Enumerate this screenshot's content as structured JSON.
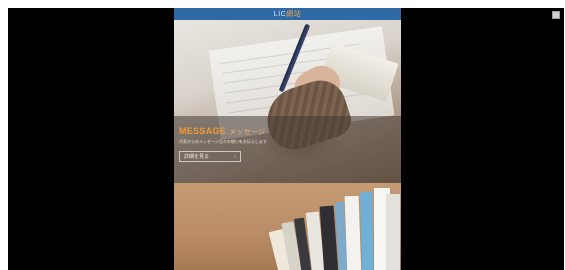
{
  "header": {
    "logo_part1": "LIC",
    "logo_part2": "網站"
  },
  "hero": {
    "title": "MESSAGE",
    "title_suffix": "メッセージ",
    "subtitle": "代表からのメッセージ日々の想いをお伝えします",
    "button_label": "詳細を見る",
    "button_arrow": "›"
  },
  "colors": {
    "header_bg": "#2f6aa7",
    "title_accent": "#f09a3a",
    "backdrop": "#000000"
  },
  "icons": {
    "expand": "expand-icon",
    "arrow": "chevron-right-icon"
  }
}
